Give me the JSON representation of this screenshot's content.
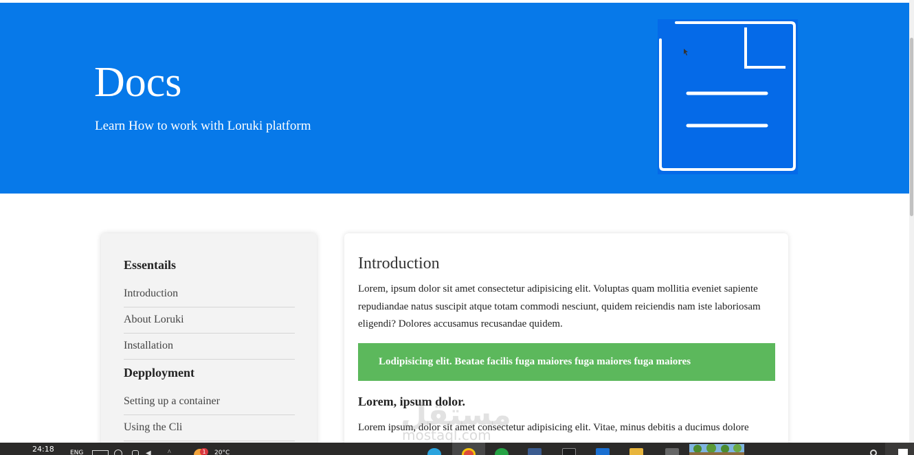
{
  "hero": {
    "title": "Docs",
    "subtitle": "Learn How to work with Loruki platform",
    "background": "#0779e9",
    "icon": "document-icon"
  },
  "sidebar": {
    "sections": [
      {
        "heading": "Essentails",
        "items": [
          "Introduction",
          "About Loruki",
          "Installation"
        ]
      },
      {
        "heading": "Depployment",
        "items": [
          "Setting up a container",
          "Using the Cli"
        ]
      }
    ]
  },
  "content": {
    "title": "Introduction",
    "paragraph1": "Lorem, ipsum dolor sit amet consectetur adipisicing elit. Voluptas quam mollitia eveniet sapiente repudiandae natus suscipit atque totam commodi nesciunt, quidem reiciendis nam iste laboriosam eligendi? Dolores accusamus recusandae quidem.",
    "callout": "Lodipisicing elit. Beatae facilis fuga maiores fuga maiores fuga maiores",
    "callout_color": "#5cb85c",
    "subtitle": "Lorem, ipsum dolor.",
    "paragraph2": "Lorem ipsum, dolor sit amet consectetur adipisicing elit. Vitae, minus debitis a ducimus dolore"
  },
  "watermark": {
    "arabic": "مستقل",
    "latin": "mostaql.com"
  },
  "taskbar": {
    "clock": "24:18",
    "language": "ENG",
    "notification_count": "1",
    "temperature": "20°C",
    "icons": [
      "keyboard-icon",
      "globe-icon",
      "network-icon",
      "volume-icon",
      "chevron-up-icon",
      "weather-icon",
      "telegram-icon",
      "chrome-icon",
      "whatsapp-icon",
      "sql-icon",
      "terminal-icon",
      "shield-icon",
      "folder-icon",
      "grid-icon",
      "search-icon",
      "windows-icon"
    ]
  }
}
